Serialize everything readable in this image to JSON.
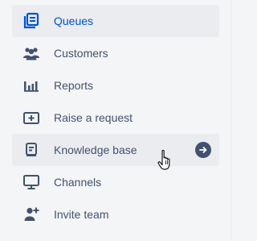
{
  "sidebar": {
    "accent_color": "#0052cc",
    "text_color": "#42526e",
    "items": [
      {
        "label": "Queues",
        "icon": "queues-icon",
        "state": "selected"
      },
      {
        "label": "Customers",
        "icon": "customers-icon",
        "state": "default"
      },
      {
        "label": "Reports",
        "icon": "reports-icon",
        "state": "default"
      },
      {
        "label": "Raise a request",
        "icon": "raise-request-icon",
        "state": "default"
      },
      {
        "label": "Knowledge base",
        "icon": "knowledge-base-icon",
        "state": "hovered"
      },
      {
        "label": "Channels",
        "icon": "channels-icon",
        "state": "default"
      },
      {
        "label": "Invite team",
        "icon": "invite-team-icon",
        "state": "default"
      }
    ]
  }
}
